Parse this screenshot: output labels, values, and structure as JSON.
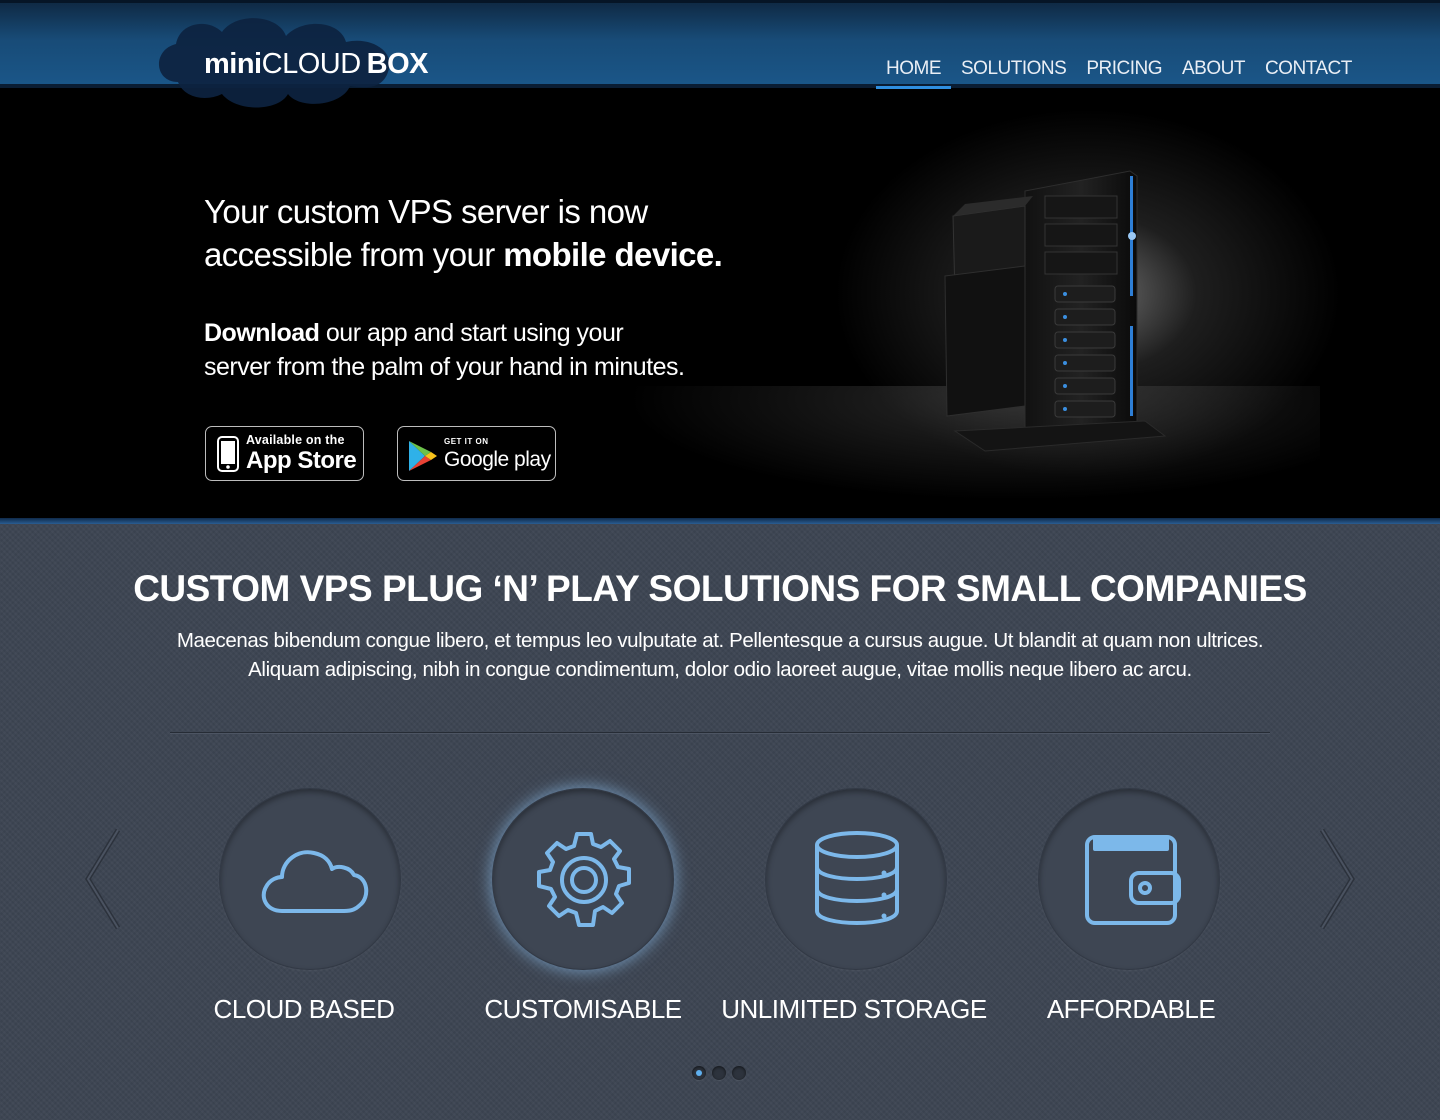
{
  "brand": {
    "logo_part1": "mini",
    "logo_part2": "CLOUD",
    "logo_part3": "BOX"
  },
  "nav": {
    "items": [
      {
        "label": "HOME",
        "active": true
      },
      {
        "label": "SOLUTIONS",
        "active": false
      },
      {
        "label": "PRICING",
        "active": false
      },
      {
        "label": "ABOUT",
        "active": false
      },
      {
        "label": "CONTACT",
        "active": false
      }
    ]
  },
  "hero": {
    "headline_line1": "Your custom VPS server is now",
    "headline_line2_normal": "accessible from your ",
    "headline_line2_bold": "mobile device.",
    "sub_bold": "Download",
    "sub_line1_rest": " our app and start using your",
    "sub_line2": "server from the palm of your hand in minutes.",
    "appstore_small": "Available on the",
    "appstore_big": "App Store",
    "googleplay_small": "GET IT ON",
    "googleplay_big": "Google play"
  },
  "main": {
    "title_normal1": "CUSTOM VPS ",
    "title_bold": "PLUG ‘N’ PLAY",
    "title_normal2": " SOLUTIONS FOR SMALL COMPANIES",
    "desc_line1": "Maecenas bibendum congue libero, et tempus leo vulputate at. Pellentesque a cursus augue. Ut blandit at quam non ultrices.",
    "desc_line2": "Aliquam adipiscing, nibh in congue condimentum, dolor odio laoreet augue, vitae mollis neque libero ac arcu."
  },
  "features": [
    {
      "label": "CLOUD BASED",
      "icon": "cloud-icon"
    },
    {
      "label": "CUSTOMISABLE",
      "icon": "gear-icon"
    },
    {
      "label": "UNLIMITED STORAGE",
      "icon": "database-icon"
    },
    {
      "label": "AFFORDABLE",
      "icon": "wallet-icon"
    }
  ],
  "carousel": {
    "page_count": 3,
    "active_page": 1
  },
  "colors": {
    "accent": "#2f8fe0",
    "icon_blue": "#7cb8ea",
    "header_blue": "#184b77",
    "main_bg": "#3c4452"
  }
}
